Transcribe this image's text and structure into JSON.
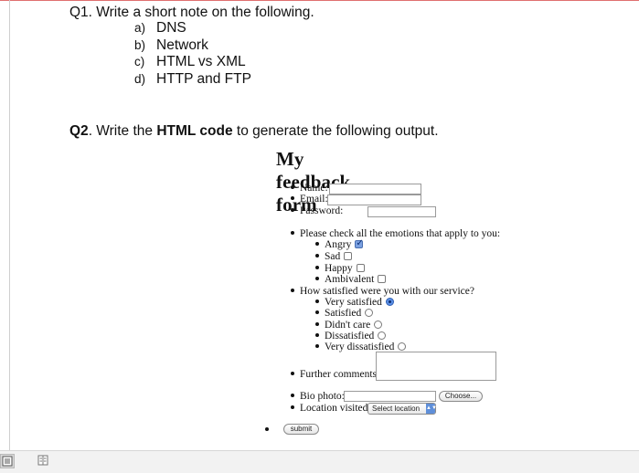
{
  "q1": {
    "heading": "Q1. Write a short note on the following.",
    "items": [
      {
        "marker": "a)",
        "text": "DNS"
      },
      {
        "marker": "b)",
        "text": "Network"
      },
      {
        "marker": "c)",
        "text": "HTML vs XML"
      },
      {
        "marker": "d)",
        "text": "HTTP and FTP"
      }
    ]
  },
  "q2": {
    "prefix": "Q2",
    "text1": ". Write the ",
    "bold": "HTML code",
    "text2": " to generate the following output."
  },
  "form": {
    "title": "My feedback form",
    "name_label": "Name:",
    "email_label": "Email:",
    "password_label": "Password:",
    "emotions_question": "Please check all the emotions that apply to you:",
    "emotions": [
      {
        "label": "Angry",
        "checked": true
      },
      {
        "label": "Sad",
        "checked": false
      },
      {
        "label": "Happy",
        "checked": false
      },
      {
        "label": "Ambivalent",
        "checked": false
      }
    ],
    "satisfaction_question": "How satisfied were you with our service?",
    "satisfaction": [
      {
        "label": "Very satisfied",
        "selected": true
      },
      {
        "label": "Satisfied",
        "selected": false
      },
      {
        "label": "Didn't care",
        "selected": false
      },
      {
        "label": "Dissatisfied",
        "selected": false
      },
      {
        "label": "Very dissatisfied",
        "selected": false
      }
    ],
    "comments_label": "Further comments:",
    "bio_photo_label": "Bio photo:",
    "choose_button": "Choose...",
    "location_label": "Location visited:",
    "location_select": "Select location",
    "submit_button": "submit"
  },
  "statusbar": {
    "views": [
      "print-layout-view-icon",
      "web-layout-view-icon"
    ]
  }
}
